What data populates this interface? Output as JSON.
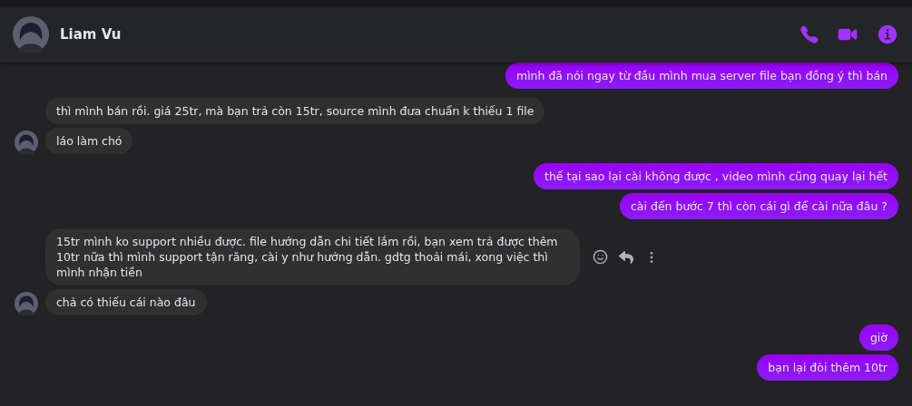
{
  "header": {
    "name": "Liam Vu"
  },
  "messages": [
    {
      "kind": "outgoing",
      "text": "mình đã nói ngay từ đầu mình mua server file bạn đồng ý thì bán",
      "avatar": false,
      "actions": false
    },
    {
      "kind": "incoming",
      "text": "thì mình bán rồi. giá 25tr, mà bạn trả còn 15tr, source mình đưa chuẩn k thiếu 1 file",
      "avatar": false,
      "actions": false
    },
    {
      "kind": "incoming",
      "text": "láo làm chó",
      "avatar": true,
      "actions": false
    },
    {
      "kind": "outgoing",
      "text": "thế tại sao lại cài không được , video mình cũng quay lại hết",
      "avatar": false,
      "actions": false
    },
    {
      "kind": "outgoing",
      "text": "cài đến bước 7 thì còn cái gì để cài nữa đâu ?",
      "avatar": false,
      "actions": false
    },
    {
      "kind": "incoming",
      "text": "15tr mình ko support nhiều được. file hướng dẫn chi tiết lắm rồi, bạn xem trả được thêm 10tr nữa thì mình support tận răng, cài y như hướng dẫn. gdtg thoải mái, xong việc thì mình nhận tiền",
      "avatar": false,
      "actions": true
    },
    {
      "kind": "incoming",
      "text": "chả có thiếu cái nào đâu",
      "avatar": true,
      "actions": false
    },
    {
      "kind": "outgoing",
      "text": "giờ",
      "avatar": false,
      "actions": false
    },
    {
      "kind": "outgoing",
      "text": "bạn lại đòi thêm 10tr",
      "avatar": false,
      "actions": false
    }
  ]
}
